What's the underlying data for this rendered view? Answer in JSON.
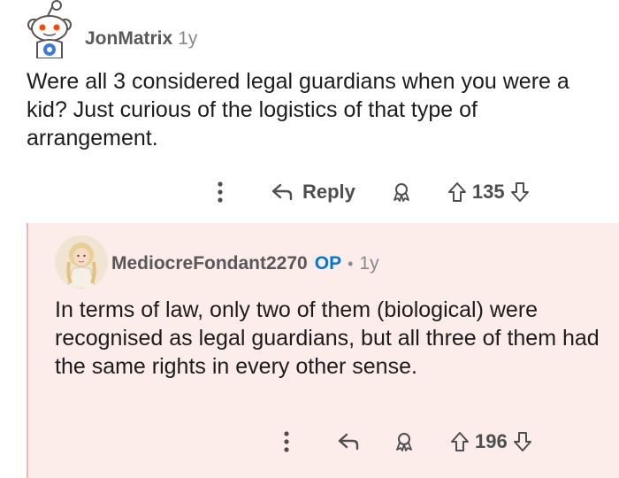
{
  "comments": [
    {
      "author": "JonMatrix",
      "age": "1y",
      "body": "Were all 3 considered legal guardians when you were a kid? Just curious of the logistics of that type of arrangement.",
      "actions": {
        "more_icon": "more-vertical-icon",
        "reply_label": "Reply",
        "reply_icon": "reply-arrow-icon",
        "award_icon": "award-icon",
        "upvote_icon": "upvote-arrow-icon",
        "score": "135",
        "downvote_icon": "downvote-arrow-icon"
      }
    },
    {
      "author": "MediocreFondant2270",
      "op_badge": "OP",
      "separator": "•",
      "age": "1y",
      "body": "In terms of law, only two of them (biological) were recognised as legal guardians, but all three of them had the same rights in every other sense.",
      "actions": {
        "more_icon": "more-vertical-icon",
        "reply_icon": "reply-arrow-icon",
        "award_icon": "award-icon",
        "upvote_icon": "upvote-arrow-icon",
        "score": "196",
        "downvote_icon": "downvote-arrow-icon"
      }
    }
  ],
  "colors": {
    "reply_background": "#fcecea",
    "thread_line": "#f0b7b0",
    "op_blue": "#0079d3",
    "snoo_orange": "#ff4500"
  }
}
